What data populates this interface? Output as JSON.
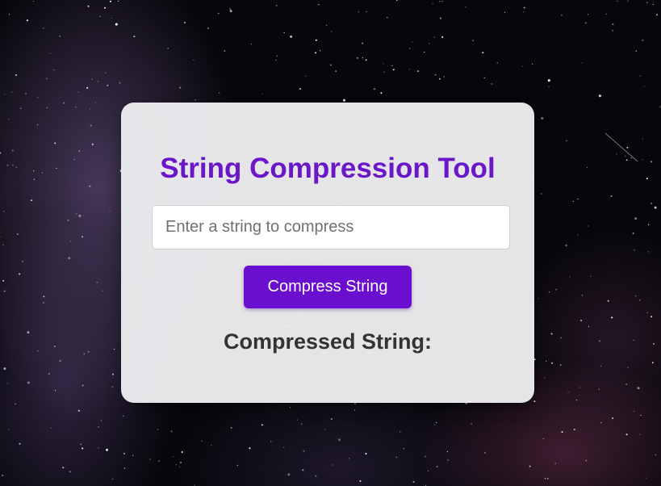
{
  "app": {
    "title": "String Compression Tool"
  },
  "input": {
    "placeholder": "Enter a string to compress",
    "value": ""
  },
  "compress_button": {
    "label": "Compress String"
  },
  "result": {
    "heading": "Compressed String:",
    "value": ""
  },
  "colors": {
    "accent": "#6a0fd0",
    "title": "#6a16c9",
    "card_background": "#ececf0",
    "text": "#333333"
  }
}
